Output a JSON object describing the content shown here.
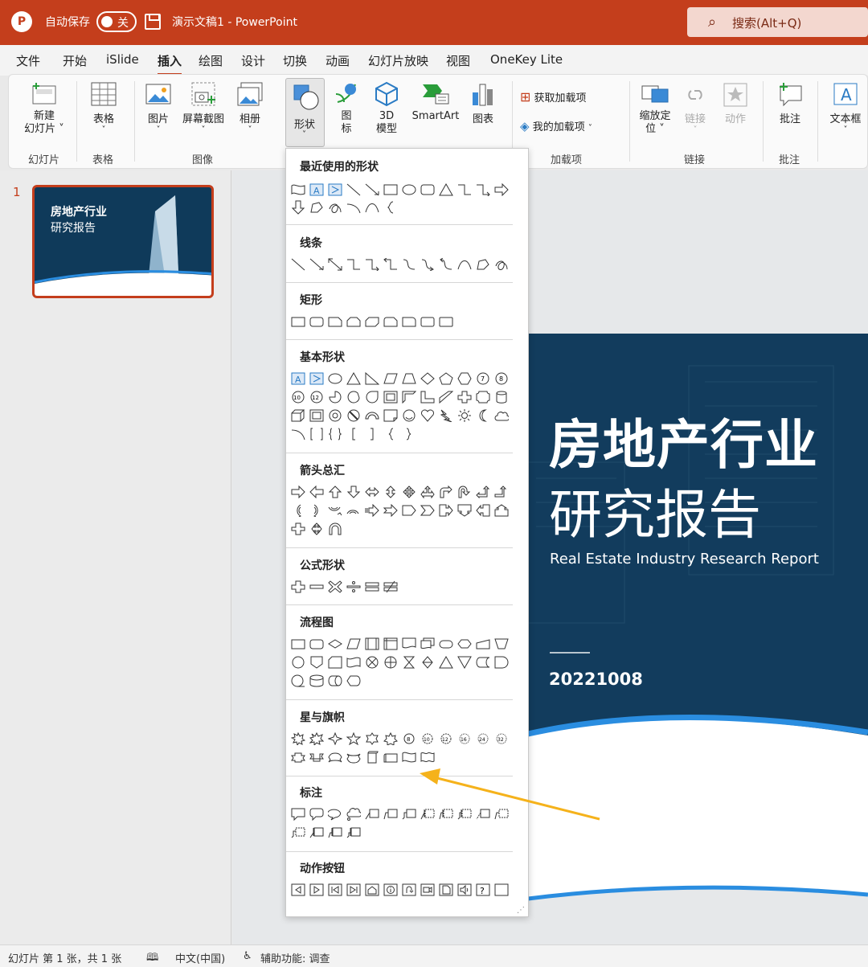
{
  "titlebar": {
    "logo": "P",
    "autosave_label": "自动保存",
    "autosave_state": "关",
    "document": "演示文稿1  -  PowerPoint",
    "search_placeholder": "搜索(Alt+Q)"
  },
  "menu": {
    "tabs": [
      "文件",
      "开始",
      "iSlide",
      "插入",
      "绘图",
      "设计",
      "切换",
      "动画",
      "幻灯片放映",
      "视图",
      "OneKey Lite"
    ],
    "active": "插入"
  },
  "ribbon": {
    "buttons": {
      "new_slide": "新建\n幻灯片 ˅",
      "table": "表格",
      "picture": "图片",
      "screenshot": "屏幕截图",
      "album": "相册",
      "shapes": "形状",
      "icons": "图\n标",
      "model3d": "3D\n模型",
      "smartart": "SmartArt",
      "chart": "图表",
      "get_addins": "获取加载项",
      "my_addins": "我的加载项",
      "zoom": "缩放定\n位 ˅",
      "link": "链接",
      "action": "动作",
      "comment": "批注",
      "textbox": "文本框"
    },
    "groups": {
      "slides": "幻灯片",
      "tables": "表格",
      "images": "图像",
      "addins": "加载项",
      "links": "链接",
      "comments": "批注"
    }
  },
  "thumbnails": {
    "number": "1",
    "title1": "房地产行业",
    "title2": "研究报告"
  },
  "slide": {
    "title_line1": "房地产行业",
    "title_line2": "研究报告",
    "subtitle": "Real Estate Industry Research Report",
    "date": "20221008"
  },
  "shapes_menu": {
    "sections": [
      "最近使用的形状",
      "线条",
      "矩形",
      "基本形状",
      "箭头总汇",
      "公式形状",
      "流程图",
      "星与旗帜",
      "标注",
      "动作按钮"
    ]
  },
  "statusbar": {
    "slide_info": "幻灯片 第 1 张，共 1 张",
    "language": "中文(中国)",
    "accessibility": "辅助功能: 调查"
  },
  "colors": {
    "accent": "#c43e1c",
    "slide_bg": "#123c5d",
    "arrow": "#f5b21b"
  }
}
